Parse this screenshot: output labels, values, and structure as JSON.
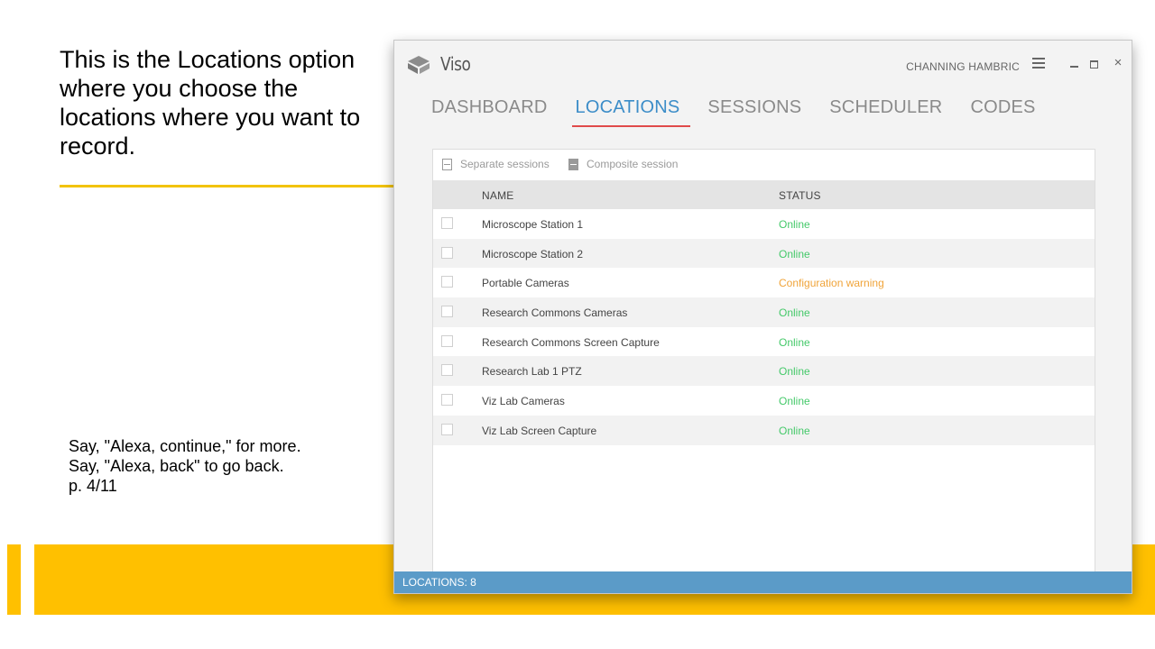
{
  "slide": {
    "heading_pre": "This is the ",
    "heading_bold": "Locations option",
    "heading_post": " where you choose the locations where you want to record.",
    "voice_line1": "Say, \"Alexa, continue,\" for more.",
    "voice_line2": "Say, \"Alexa, back\" to go back.",
    "page": "p. 4/11"
  },
  "app": {
    "name": "Viso",
    "user": "CHANNING HAMBRIC",
    "close_glyph": "×",
    "tabs": [
      {
        "label": "DASHBOARD"
      },
      {
        "label": "LOCATIONS"
      },
      {
        "label": "SESSIONS"
      },
      {
        "label": "SCHEDULER"
      },
      {
        "label": "CODES"
      }
    ],
    "active_tab": "LOCATIONS",
    "toolbar": {
      "separate": "Separate sessions",
      "composite": "Composite session"
    },
    "columns": {
      "name": "NAME",
      "status": "STATUS"
    },
    "rows": [
      {
        "name": "Microscope Station 1",
        "status": "Online"
      },
      {
        "name": "Microscope Station 2",
        "status": "Online"
      },
      {
        "name": "Portable Cameras",
        "status": "Configuration warning"
      },
      {
        "name": "Research Commons Cameras",
        "status": "Online"
      },
      {
        "name": "Research Commons Screen Capture",
        "status": "Online"
      },
      {
        "name": "Research Lab 1 PTZ",
        "status": "Online"
      },
      {
        "name": "Viz Lab Cameras",
        "status": "Online"
      },
      {
        "name": "Viz Lab Screen Capture",
        "status": "Online"
      }
    ],
    "statusbar": "LOCATIONS: 8"
  },
  "colors": {
    "accent_tab": "#3c8dc8",
    "tab_underline": "#e04a4a",
    "online": "#45c96a",
    "warning": "#f0a43a",
    "statusbar": "#5b9bc8",
    "band": "#ffc000"
  },
  "icons": {
    "logo": "viso-cube-icon",
    "menu": "hamburger-icon",
    "minimize": "minimize-icon",
    "maximize": "maximize-icon",
    "close": "close-icon",
    "toolbar": "document-icon"
  }
}
